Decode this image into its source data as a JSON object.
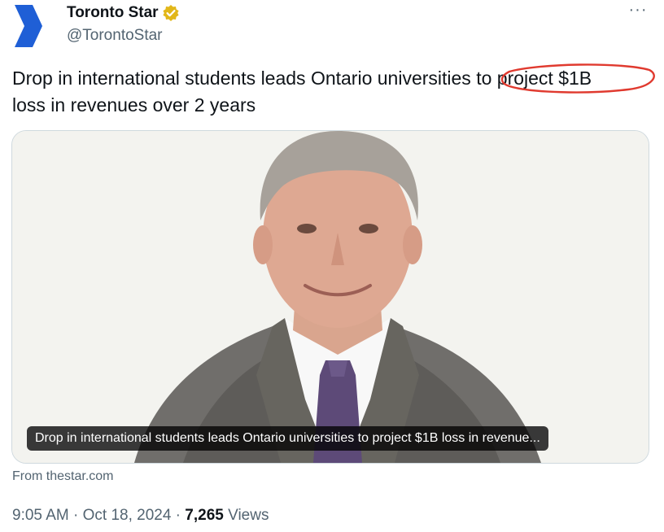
{
  "author": {
    "name": "Toronto Star",
    "handle": "@TorontoStar",
    "brand_color": "#1f5fd6",
    "verified_badge_color": "#e2b719"
  },
  "menu": {
    "more_label": "···"
  },
  "tweet": {
    "text_before": "Drop in international students leads Ontario universities ",
    "text_highlight": "to project $1B",
    "text_after": " loss in revenues over 2 years",
    "annotation_color": "#e03a2f"
  },
  "card": {
    "caption": "Drop in international students leads Ontario universities to project $1B loss in revenue...",
    "source_prefix": "From ",
    "source_domain": "thestar.com",
    "image_subject": "portrait-man-in-grey-suit"
  },
  "meta": {
    "time": "9:05 AM",
    "separator": " · ",
    "date": "Oct 18, 2024",
    "views_count": "7,265",
    "views_label": " Views"
  }
}
